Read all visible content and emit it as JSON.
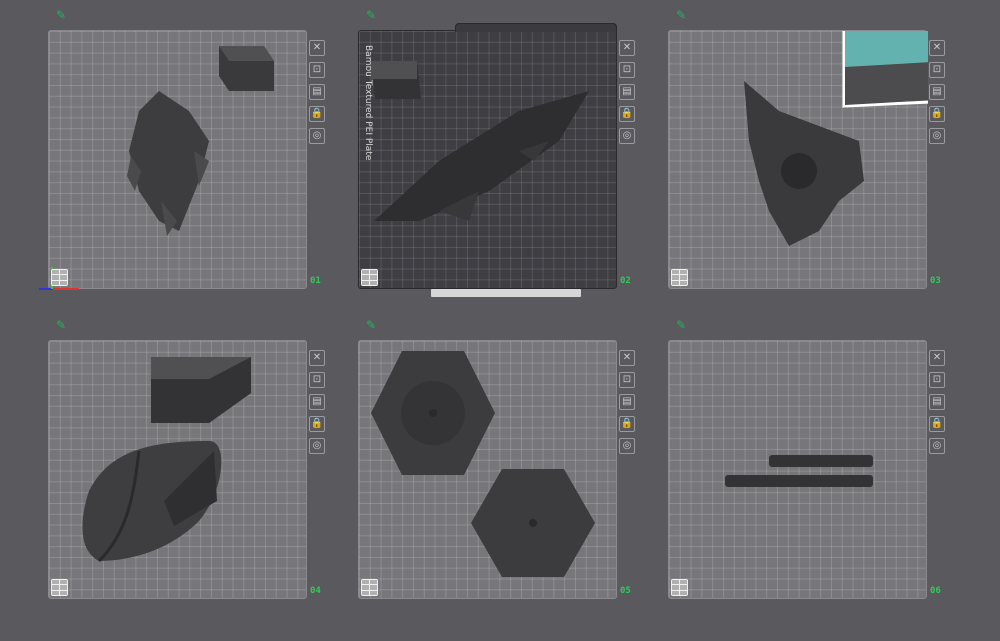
{
  "plates": [
    {
      "number": "01",
      "edit_icon": "pencil-icon",
      "label": ""
    },
    {
      "number": "02",
      "edit_icon": "pencil-icon",
      "label": "Bambu Textured PEI Plate",
      "selected": true
    },
    {
      "number": "03",
      "edit_icon": "pencil-icon",
      "label": ""
    },
    {
      "number": "04",
      "edit_icon": "pencil-icon",
      "label": ""
    },
    {
      "number": "05",
      "edit_icon": "pencil-icon",
      "label": ""
    },
    {
      "number": "06",
      "edit_icon": "pencil-icon",
      "label": ""
    }
  ],
  "toolbar_icons": [
    "close-icon",
    "camera-icon",
    "layout-icon",
    "lock-icon",
    "settings-icon"
  ],
  "toolbar_glyphs": [
    "✕",
    "⊡",
    "▤",
    "🔒",
    "◎"
  ],
  "colors": {
    "background": "#5a5a5e",
    "plate": "#77777b",
    "plate_selected": "#3e3e43",
    "accent": "#2ecc55",
    "highlight": "#63b2b0"
  }
}
